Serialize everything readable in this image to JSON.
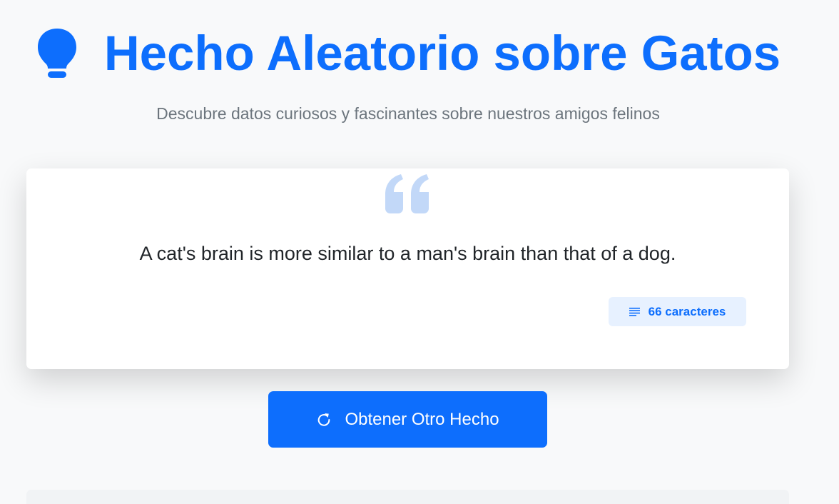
{
  "header": {
    "icon": "lightbulb-icon",
    "title": "Hecho Aleatorio sobre Gatos",
    "subtitle": "Descubre datos curiosos y fascinantes sobre nuestros amigos felinos"
  },
  "fact_card": {
    "quote_icon": "quote-icon",
    "fact_text": "A cat's brain is more similar to a man's brain than that of a dog.",
    "badge": {
      "icon": "text-lines-icon",
      "label": "66 caracteres"
    }
  },
  "actions": {
    "new_fact_button": {
      "icon": "refresh-icon",
      "label": "Obtener Otro Hecho"
    }
  },
  "colors": {
    "primary": "#0d6efd",
    "badge_background": "#e7f1ff",
    "quote_mark": "#c2d8f8",
    "page_background": "#f8f9fa",
    "muted_text": "#6c757d"
  }
}
